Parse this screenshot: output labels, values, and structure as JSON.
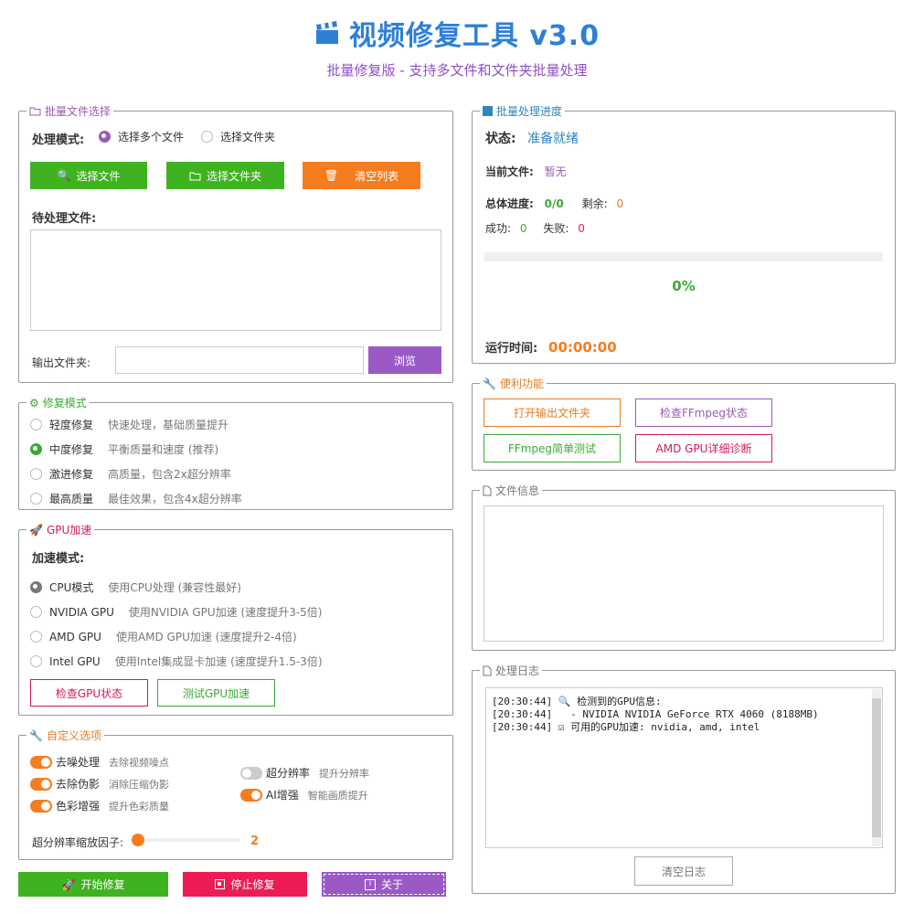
{
  "header": {
    "title": "视频修复工具 v3.0",
    "subtitle": "批量修复版 - 支持多文件和文件夹批量处理"
  },
  "files": {
    "legend": "批量文件选择",
    "mode_label": "处理模式:",
    "mode_options": [
      "选择多个文件",
      "选择文件夹"
    ],
    "btn_select_files": "选择文件",
    "btn_select_folder": "选择文件夹",
    "btn_clear_list": "清空列表",
    "pending_label": "待处理文件:",
    "output_label": "输出文件夹:",
    "output_value": "",
    "btn_browse": "浏览"
  },
  "repair": {
    "legend": "修复模式",
    "options": [
      {
        "label": "轻度修复",
        "desc": "快速处理，基础质量提升"
      },
      {
        "label": "中度修复",
        "desc": "平衡质量和速度 (推荐)"
      },
      {
        "label": "激进修复",
        "desc": "高质量，包含2x超分辨率"
      },
      {
        "label": "最高质量",
        "desc": "最佳效果，包含4x超分辨率"
      }
    ],
    "selected": 1
  },
  "gpu": {
    "legend": "GPU加速",
    "mode_label": "加速模式:",
    "options": [
      {
        "label": "CPU模式",
        "desc": "使用CPU处理 (兼容性最好)"
      },
      {
        "label": "NVIDIA GPU",
        "desc": "使用NVIDIA GPU加速 (速度提升3-5倍)"
      },
      {
        "label": "AMD GPU",
        "desc": "使用AMD GPU加速 (速度提升2-4倍)"
      },
      {
        "label": "Intel GPU",
        "desc": "使用Intel集成显卡加速 (速度提升1.5-3倍)"
      }
    ],
    "selected": 0,
    "btn_check": "检查GPU状态",
    "btn_test": "测试GPU加速"
  },
  "custom": {
    "legend": "自定义选项",
    "toggles": [
      {
        "label": "去噪处理",
        "desc": "去除视频噪点",
        "on": true
      },
      {
        "label": "去除伪影",
        "desc": "消除压缩伪影",
        "on": true
      },
      {
        "label": "色彩增强",
        "desc": "提升色彩质量",
        "on": true
      },
      {
        "label": "超分辨率",
        "desc": "提升分辨率",
        "on": false
      },
      {
        "label": "AI增强",
        "desc": "智能画质提升",
        "on": true
      }
    ],
    "scale_label": "超分辨率缩放因子:",
    "scale_value": "2"
  },
  "actions": {
    "start": "开始修复",
    "stop": "停止修复",
    "about": "关于"
  },
  "progress": {
    "legend": "批量处理进度",
    "status_label": "状态:",
    "status_value": "准备就绪",
    "current_label": "当前文件:",
    "current_value": "暂无",
    "total_label": "总体进度:",
    "total_value": "0/0",
    "remaining_label": "剩余:",
    "remaining_value": "0",
    "success_label": "成功:",
    "success_value": "0",
    "fail_label": "失败:",
    "fail_value": "0",
    "percent": "0%",
    "runtime_label": "运行时间:",
    "runtime_value": "00:00:00"
  },
  "util": {
    "legend": "便利功能",
    "btn_open_output": "打开输出文件夹",
    "btn_check_ffmpeg": "检查FFmpeg状态",
    "btn_ffmpeg_test": "FFmpeg简单测试",
    "btn_amd_diag": "AMD GPU详细诊断"
  },
  "info": {
    "legend": "文件信息"
  },
  "log": {
    "legend": "处理日志",
    "lines": [
      "[20:30:44] 🔍 检测到的GPU信息:",
      "[20:30:44]   - NVIDIA NVIDIA GeForce RTX 4060 (8188MB)",
      "[20:30:44] ☑ 可用的GPU加速: nvidia, amd, intel"
    ],
    "btn_clear": "清空日志"
  },
  "colors": {
    "blue": "#2f7fd6",
    "purple": "#9b59b6",
    "green": "#3fb31f",
    "orange": "#f57c1f",
    "red": "#ee1c55"
  }
}
